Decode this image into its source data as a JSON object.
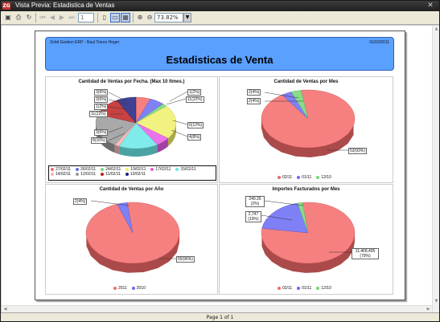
{
  "window": {
    "title": "Vista Previa: Estadistica de Ventas",
    "app_badge": "ZG",
    "close_glyph": "✕"
  },
  "toolbar": {
    "page_value": "1",
    "zoom_value": "73.82%"
  },
  "report": {
    "company": "Zebit Gestion ERP - Raul Torres Hoger",
    "date": "01/03/2011",
    "title": "Estadisticas de Venta"
  },
  "chart_data": [
    {
      "type": "pie",
      "title": "Cantidad de Ventas por Fecha. (Max 10 Itmes.)",
      "categories": [
        "27/02/11",
        "26/02/11",
        "24/02/11",
        "19/02/11",
        "17/02/11",
        "15/02/11",
        "14/02/11",
        "12/02/11",
        "11/02/11",
        "10/02/11"
      ],
      "labels": [
        "3(6%)",
        "3(6%)",
        "1(2%)",
        "11(22%)",
        "3(6%)",
        "8(16%)",
        "1(2%)",
        "11(22%)",
        "6(12%)",
        "4(8%)"
      ],
      "colors": [
        "#f46a6a",
        "#6a6af4",
        "#74d674",
        "#f0f06a",
        "#e85ae8",
        "#6ae8e8",
        "#f4b4b4",
        "#9a9a9a",
        "#c02020",
        "#202080"
      ]
    },
    {
      "type": "pie",
      "title": "Cantidad de Ventas por Mes",
      "categories": [
        "02/11",
        "01/11",
        "12/10"
      ],
      "values": [
        53,
        2,
        2
      ],
      "labels": [
        "53(93%)",
        "2(4%)",
        "2(4%)"
      ],
      "colors": [
        "#f46a6a",
        "#6a6af4",
        "#74d674"
      ]
    },
    {
      "type": "pie",
      "title": "Cantidad de Ventas por Año",
      "categories": [
        "2011",
        "2010"
      ],
      "values": [
        55,
        2
      ],
      "labels": [
        "55(96%)",
        "2(4%)"
      ],
      "colors": [
        "#f46a6a",
        "#6a6af4"
      ]
    },
    {
      "type": "pie",
      "title": "Importes Facturados por Mes",
      "categories": [
        "02/11",
        "01/11",
        "12/10"
      ],
      "values": [
        11468.405,
        2747,
        249.26
      ],
      "labels": [
        "11,468,405 (79%)",
        "2,747 (19%)",
        "249.26 (2%)"
      ],
      "colors": [
        "#f46a6a",
        "#6a6af4",
        "#74d674"
      ]
    }
  ],
  "status": {
    "page_info": "Page 1 of 1"
  }
}
